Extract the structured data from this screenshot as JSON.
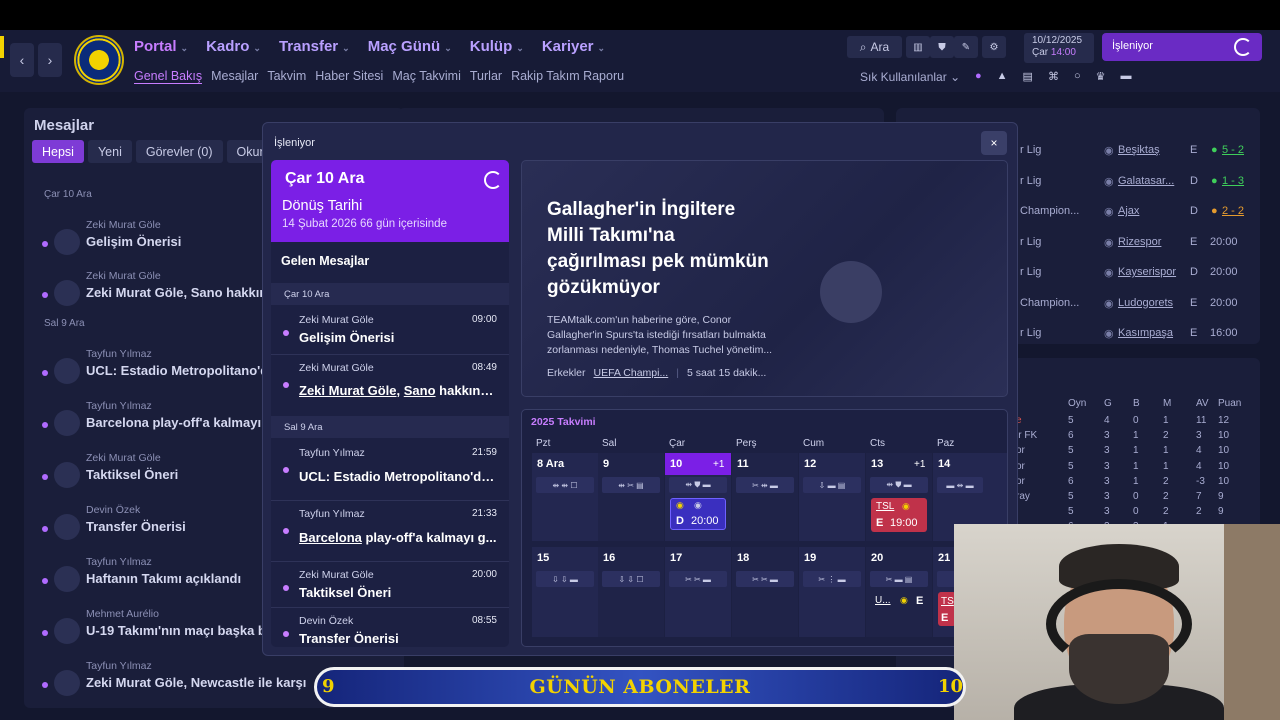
{
  "header": {
    "nav": [
      "Portal",
      "Kadro",
      "Transfer",
      "Maç Günü",
      "Kulüp",
      "Kariyer"
    ],
    "subnav": [
      "Genel Bakış",
      "Mesajlar",
      "Takvim",
      "Haber Sitesi",
      "Maç Takvimi",
      "Turlar",
      "Rakip Takım Raporu"
    ],
    "search_label": "Ara",
    "date": "10/12/2025",
    "day": "Çar",
    "time": "14:00",
    "processing": "İşleniyor",
    "frequent": "Sık Kullanılanlar"
  },
  "left_panel": {
    "title": "Mesajlar",
    "tabs": [
      "Hepsi",
      "Yeni",
      "Görevler (0)",
      "Okunm"
    ],
    "dates": [
      "Çar 10 Ara",
      "Sal 9 Ara"
    ],
    "messages": [
      {
        "from": "Zeki Murat Göle",
        "subject": "Gelişim Önerisi"
      },
      {
        "from": "Zeki Murat Göle",
        "subject": "Zeki Murat Göle, Sano hakkında"
      },
      {
        "from": "Tayfun Yılmaz",
        "subject": "UCL: Estadio Metropolitano'da"
      },
      {
        "from": "Tayfun Yılmaz",
        "subject": "Barcelona play-off'a kalmayı"
      },
      {
        "from": "Zeki Murat Göle",
        "subject": "Taktiksel Öneri"
      },
      {
        "from": "Devin Özek",
        "subject": "Transfer Önerisi"
      },
      {
        "from": "Tayfun Yılmaz",
        "subject": "Haftanın Takımı açıklandı"
      },
      {
        "from": "Mehmet Aurélio",
        "subject": "U-19 Takımı'nın maçı başka b"
      },
      {
        "from": "Tayfun Yılmaz",
        "subject": "Zeki Murat Göle, Newcastle ile karşıla"
      }
    ]
  },
  "fixtures": [
    {
      "comp": "r Lig",
      "team": "Beşiktaş",
      "venue": "E",
      "result": "5 - 2",
      "color": "#3fcf5a"
    },
    {
      "comp": "r Lig",
      "team": "Galatasar...",
      "venue": "D",
      "result": "1 - 3",
      "color": "#3fcf5a"
    },
    {
      "comp": "Champion...",
      "team": "Ajax",
      "venue": "D",
      "result": "2 - 2",
      "color": "#e59b2e"
    },
    {
      "comp": "r Lig",
      "team": "Rizespor",
      "venue": "E",
      "result": "20:00",
      "color": ""
    },
    {
      "comp": "r Lig",
      "team": "Kayserispor",
      "venue": "D",
      "result": "20:00",
      "color": ""
    },
    {
      "comp": "Champion...",
      "team": "Ludogorets",
      "venue": "E",
      "result": "20:00",
      "color": ""
    },
    {
      "comp": "r Lig",
      "team": "Kasımpaşa",
      "venue": "E",
      "result": "16:00",
      "color": ""
    }
  ],
  "table": {
    "headers": [
      "Oyn",
      "G",
      "B",
      "M",
      "AV",
      "Puan"
    ],
    "rows": [
      {
        "name": "e",
        "vals": [
          "5",
          "4",
          "0",
          "1",
          "11",
          "12"
        ]
      },
      {
        "name": "ir FK",
        "vals": [
          "6",
          "3",
          "1",
          "2",
          "3",
          "10"
        ]
      },
      {
        "name": "or",
        "vals": [
          "5",
          "3",
          "1",
          "1",
          "4",
          "10"
        ]
      },
      {
        "name": "or",
        "vals": [
          "5",
          "3",
          "1",
          "1",
          "4",
          "10"
        ]
      },
      {
        "name": "or",
        "vals": [
          "6",
          "3",
          "1",
          "2",
          "-3",
          "10"
        ]
      },
      {
        "name": "ray",
        "vals": [
          "5",
          "3",
          "0",
          "2",
          "7",
          "9"
        ]
      },
      {
        "name": "",
        "vals": [
          "5",
          "3",
          "0",
          "2",
          "2",
          "9"
        ]
      },
      {
        "name": "",
        "vals": [
          "6",
          "2",
          "3",
          "1",
          "",
          ""
        ]
      }
    ]
  },
  "modal": {
    "title": "İşleniyor",
    "close": "×",
    "head_date": "Çar 10 Ara",
    "return_label": "Dönüş Tarihi",
    "return_sub": "14 Şubat 2026  66 gün içerisinde",
    "incoming": "Gelen Mesajlar",
    "groups": [
      {
        "date": "Çar 10 Ara",
        "items": [
          {
            "from": "Zeki Murat Göle",
            "time": "09:00",
            "subject": "Gelişim Önerisi"
          },
          {
            "from": "Zeki Murat Göle",
            "time": "08:49",
            "subject_u1": "Zeki Murat Göle",
            "subject_mid": ", ",
            "subject_u2": "Sano",
            "subject_rest": " hakkında..."
          }
        ]
      },
      {
        "date": "Sal 9 Ara",
        "items": [
          {
            "from": "Tayfun Yılmaz",
            "time": "21:59",
            "subject": "UCL: Estadio Metropolitano'da ..."
          },
          {
            "from": "Tayfun Yılmaz",
            "time": "21:33",
            "subject_u1": "Barcelona",
            "subject_rest": " play-off'a kalmayı g..."
          },
          {
            "from": "Zeki Murat Göle",
            "time": "20:00",
            "subject": "Taktiksel Öneri"
          },
          {
            "from": "Devin Özek",
            "time": "08:55",
            "subject": "Transfer Önerisi"
          }
        ]
      }
    ],
    "news": {
      "headline": "Gallagher'in İngiltere Milli Takımı'na çağırılması pek mümkün gözükmüyor",
      "body": "TEAMtalk.com'un haberine göre, Conor Gallagher'in Spurs'ta istediği fırsatları bulmakta zorlanması nedeniyle, Thomas Tuchel yönetim...",
      "tag1": "Erkekler",
      "tag2": "UEFA Champi...",
      "ago": "5 saat 15 dakik..."
    },
    "calendar": {
      "title": "2025 Takvimi",
      "dow": [
        "Pzt",
        "Sal",
        "Çar",
        "Perş",
        "Cum",
        "Cts",
        "Paz"
      ],
      "week1": [
        {
          "num": "8 Ara",
          "plus": "",
          "icons": "⇹ ⇹ ☐"
        },
        {
          "num": "9",
          "plus": "",
          "icons": "⇹ ✂ ▤"
        },
        {
          "num": "10",
          "plus": "+1",
          "icons": "⇹ ⛊ ▬"
        },
        {
          "num": "11",
          "plus": "",
          "icons": "✂ ⇹ ▬"
        },
        {
          "num": "12",
          "plus": "",
          "icons": "⇩ ▬ ▤"
        },
        {
          "num": "13",
          "plus": "+1",
          "icons": "⇹ ⛊ ▬"
        },
        {
          "num": "14",
          "plus": "",
          "icons": "▬ ⇹ ▬"
        }
      ],
      "week2": [
        {
          "num": "15",
          "icons": "⇩ ⇩ ▬"
        },
        {
          "num": "16",
          "icons": "⇩ ⇩ ☐"
        },
        {
          "num": "17",
          "icons": "✂ ✂ ▬"
        },
        {
          "num": "18",
          "icons": "✂ ✂ ▬"
        },
        {
          "num": "19",
          "icons": "✂ ⋮ ▬"
        },
        {
          "num": "20",
          "icons": "✂ ▬ ▤"
        },
        {
          "num": "21",
          "icons": "⇩"
        }
      ],
      "match_wed": {
        "venue": "D",
        "time": "20:00"
      },
      "match_sat": {
        "comp": "TSL",
        "venue": "E",
        "time": "19:00"
      },
      "match_sat2": {
        "comp": "U...",
        "venue": "E"
      },
      "match_sun2": {
        "comp": "TS",
        "venue": "E"
      }
    }
  },
  "banner": {
    "left_num": "9",
    "text": "GÜNÜN ABONELER",
    "right_num": "10"
  }
}
